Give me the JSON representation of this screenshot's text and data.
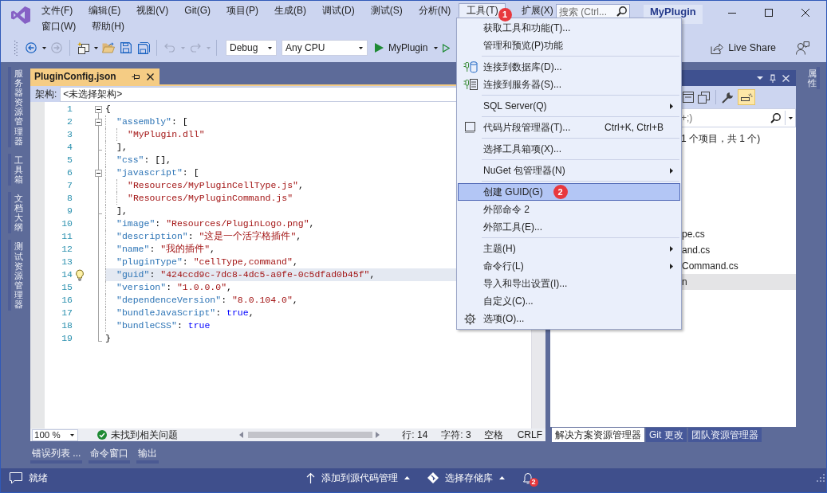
{
  "window": {
    "title": "MyPlugin",
    "search": {
      "placeholder": "搜索 (Ctrl..."
    }
  },
  "menu_bar": [
    [
      {
        "label": "文件(F)",
        "selected": false
      },
      {
        "label": "编辑(E)",
        "selected": false
      },
      {
        "label": "视图(V)",
        "selected": false
      },
      {
        "label": "Git(G)",
        "selected": false
      },
      {
        "label": "项目(P)",
        "selected": false
      },
      {
        "label": "生成(B)",
        "selected": false
      },
      {
        "label": "调试(D)",
        "selected": false
      },
      {
        "label": "测试(S)",
        "selected": false
      },
      {
        "label": "分析(N)",
        "selected": false
      },
      {
        "label": "工具(T)",
        "selected": true,
        "badge": "1"
      },
      {
        "label": "扩展(X)",
        "selected": false
      }
    ],
    [
      {
        "label": "窗口(W)",
        "selected": false
      },
      {
        "label": "帮助(H)",
        "selected": false
      }
    ]
  ],
  "toolbar": {
    "buttons": [
      {
        "disabled": false,
        "dropdown": true
      },
      {
        "disabled": true,
        "dropdown": false
      },
      {
        "disabled": false,
        "dropdown": true
      },
      {
        "disabled": false,
        "dropdown": false
      },
      {
        "disabled": false,
        "dropdown": false
      },
      {
        "disabled": false,
        "dropdown": false
      },
      {
        "disabled": true,
        "dropdown": true
      },
      {
        "disabled": true,
        "dropdown": true
      }
    ],
    "configuration": "Debug",
    "platform": "Any CPU",
    "run_target": "MyPlugin",
    "live_share": "Live Share"
  },
  "left_dock": [
    "服务器资源管理器",
    "工具箱",
    "文档大纲",
    "测试资源管理器"
  ],
  "editor": {
    "tab": {
      "title": "PluginConfig.json",
      "selected": true
    },
    "nav_label": "架构:",
    "nav_value": "<未选择架构>",
    "lines": [
      {
        "number": "1",
        "fold": true,
        "current": false,
        "hint": false,
        "tokens": [
          {
            "kind": "punct",
            "text": "{"
          }
        ],
        "children": [
          {
            "number": "2",
            "fold": true,
            "current": false,
            "hint": false,
            "tokens": [
              {
                "kind": "key",
                "text": "\"assembly\""
              },
              {
                "kind": "punct",
                "text": ": ["
              }
            ],
            "children": [
              {
                "number": "3",
                "fold": false,
                "current": false,
                "hint": false,
                "tokens": [
                  {
                    "kind": "string",
                    "text": "\"MyPlugin.dll\""
                  }
                ]
              }
            ]
          },
          {
            "number": "4",
            "fold": false,
            "current": false,
            "hint": false,
            "tokens": [
              {
                "kind": "punct",
                "text": "],"
              }
            ]
          },
          {
            "number": "5",
            "fold": false,
            "current": false,
            "hint": false,
            "tokens": [
              {
                "kind": "key",
                "text": "\"css\""
              },
              {
                "kind": "punct",
                "text": ": [],"
              }
            ]
          },
          {
            "number": "6",
            "fold": true,
            "current": false,
            "hint": false,
            "tokens": [
              {
                "kind": "key",
                "text": "\"javascript\""
              },
              {
                "kind": "punct",
                "text": ": ["
              }
            ],
            "children": [
              {
                "number": "7",
                "fold": false,
                "current": false,
                "hint": false,
                "tokens": [
                  {
                    "kind": "string",
                    "text": "\"Resources/MyPluginCellType.js\""
                  },
                  {
                    "kind": "punct",
                    "text": ","
                  }
                ]
              },
              {
                "number": "8",
                "fold": false,
                "current": false,
                "hint": false,
                "tokens": [
                  {
                    "kind": "string",
                    "text": "\"Resources/MyPluginCommand.js\""
                  }
                ]
              }
            ]
          },
          {
            "number": "9",
            "fold": false,
            "current": false,
            "hint": false,
            "tokens": [
              {
                "kind": "punct",
                "text": "],"
              }
            ]
          },
          {
            "number": "10",
            "fold": false,
            "current": false,
            "hint": false,
            "tokens": [
              {
                "kind": "key",
                "text": "\"image\""
              },
              {
                "kind": "punct",
                "text": ": "
              },
              {
                "kind": "string",
                "text": "\"Resources/PluginLogo.png\""
              },
              {
                "kind": "punct",
                "text": ","
              }
            ]
          },
          {
            "number": "11",
            "fold": false,
            "current": false,
            "hint": false,
            "tokens": [
              {
                "kind": "key",
                "text": "\"description\""
              },
              {
                "kind": "punct",
                "text": ": "
              },
              {
                "kind": "string",
                "text": "\"这是一个活字格插件\""
              },
              {
                "kind": "punct",
                "text": ","
              }
            ]
          },
          {
            "number": "12",
            "fold": false,
            "current": false,
            "hint": false,
            "tokens": [
              {
                "kind": "key",
                "text": "\"name\""
              },
              {
                "kind": "punct",
                "text": ": "
              },
              {
                "kind": "string",
                "text": "\"我的插件\""
              },
              {
                "kind": "punct",
                "text": ","
              }
            ]
          },
          {
            "number": "13",
            "fold": false,
            "current": false,
            "hint": false,
            "tokens": [
              {
                "kind": "key",
                "text": "\"pluginType\""
              },
              {
                "kind": "punct",
                "text": ": "
              },
              {
                "kind": "string",
                "text": "\"cellType,command\""
              },
              {
                "kind": "punct",
                "text": ","
              }
            ]
          },
          {
            "number": "14",
            "fold": false,
            "current": true,
            "hint": true,
            "tokens": [
              {
                "kind": "key",
                "text": "\"guid\""
              },
              {
                "kind": "punct",
                "text": ": "
              },
              {
                "kind": "string",
                "text": "\"424ccd9c-7dc8-4dc5-a0fe-0c5dfad0b45f\""
              },
              {
                "kind": "punct",
                "text": ","
              }
            ]
          },
          {
            "number": "15",
            "fold": false,
            "current": false,
            "hint": false,
            "tokens": [
              {
                "kind": "key",
                "text": "\"version\""
              },
              {
                "kind": "punct",
                "text": ": "
              },
              {
                "kind": "string",
                "text": "\"1.0.0.0\""
              },
              {
                "kind": "punct",
                "text": ","
              }
            ]
          },
          {
            "number": "16",
            "fold": false,
            "current": false,
            "hint": false,
            "tokens": [
              {
                "kind": "key",
                "text": "\"dependenceVersion\""
              },
              {
                "kind": "punct",
                "text": ": "
              },
              {
                "kind": "string",
                "text": "\"8.0.104.0\""
              },
              {
                "kind": "punct",
                "text": ","
              }
            ]
          },
          {
            "number": "17",
            "fold": false,
            "current": false,
            "hint": false,
            "tokens": [
              {
                "kind": "key",
                "text": "\"bundleJavaScript\""
              },
              {
                "kind": "punct",
                "text": ": "
              },
              {
                "kind": "literal",
                "text": "true"
              },
              {
                "kind": "punct",
                "text": ","
              }
            ]
          },
          {
            "number": "18",
            "fold": false,
            "current": false,
            "hint": false,
            "tokens": [
              {
                "kind": "key",
                "text": "\"bundleCSS\""
              },
              {
                "kind": "punct",
                "text": ": "
              },
              {
                "kind": "literal",
                "text": "true"
              }
            ]
          }
        ]
      },
      {
        "number": "19",
        "fold": false,
        "current": false,
        "hint": false,
        "tokens": [
          {
            "kind": "punct",
            "text": "}"
          }
        ]
      }
    ],
    "status": {
      "zoom": "100 %",
      "issues": "未找到相关问题",
      "line": "行: 14",
      "column": "字符: 3",
      "indent": "空格",
      "line_ending": "CRLF"
    }
  },
  "solution_explorer": {
    "toolbar": [
      {
        "on": false
      },
      {
        "on": false
      },
      {
        "on": false
      },
      {
        "on": true
      }
    ],
    "search": {
      "placeholder": "+;)"
    },
    "summary": "1 个项目，共 1 个)",
    "items": [
      {
        "label": "pe.cs",
        "selected": false
      },
      {
        "label": "and.cs",
        "selected": false
      },
      {
        "label": "Command.cs",
        "selected": false
      },
      {
        "label": "n",
        "selected": true
      }
    ],
    "tabs": [
      {
        "label": "解决方案资源管理器",
        "selected": true
      },
      {
        "label": "Git 更改",
        "selected": false
      },
      {
        "label": "团队资源管理器",
        "selected": false
      }
    ]
  },
  "right_dock": [
    "属性"
  ],
  "bottom_tabs": [
    "错误列表 ...",
    "命令窗口",
    "输出"
  ],
  "status_bar": {
    "message": "就绪",
    "source_control": "添加到源代码管理",
    "repository": "选择存储库",
    "notifications": "2"
  },
  "tools_menu": {
    "groups": [
      [
        {
          "label": "获取工具和功能(T)...",
          "selected": false,
          "submenu": false
        },
        {
          "label": "管理和预览(P)功能",
          "selected": false,
          "submenu": false
        }
      ],
      [
        {
          "label": "连接到数据库(D)...",
          "selected": false,
          "submenu": false
        },
        {
          "label": "连接到服务器(S)...",
          "selected": false,
          "submenu": false
        }
      ],
      [
        {
          "label": "SQL Server(Q)",
          "selected": false,
          "submenu": true
        }
      ],
      [
        {
          "label": "代码片段管理器(T)...",
          "selected": false,
          "submenu": false,
          "shortcut": "Ctrl+K, Ctrl+B"
        }
      ],
      [
        {
          "label": "选择工具箱项(X)...",
          "selected": false,
          "submenu": false
        }
      ],
      [
        {
          "label": "NuGet 包管理器(N)",
          "selected": false,
          "submenu": true
        }
      ],
      [
        {
          "label": "创建 GUID(G)",
          "selected": true,
          "submenu": false,
          "badge": "2"
        },
        {
          "label": "外部命令 2",
          "selected": false,
          "submenu": false
        },
        {
          "label": "外部工具(E)...",
          "selected": false,
          "submenu": false
        }
      ],
      [
        {
          "label": "主题(H)",
          "selected": false,
          "submenu": true
        },
        {
          "label": "命令行(L)",
          "selected": false,
          "submenu": true
        },
        {
          "label": "导入和导出设置(I)...",
          "selected": false,
          "submenu": false
        },
        {
          "label": "自定义(C)...",
          "selected": false,
          "submenu": false
        },
        {
          "label": "选项(O)...",
          "selected": false,
          "submenu": false
        }
      ]
    ]
  }
}
